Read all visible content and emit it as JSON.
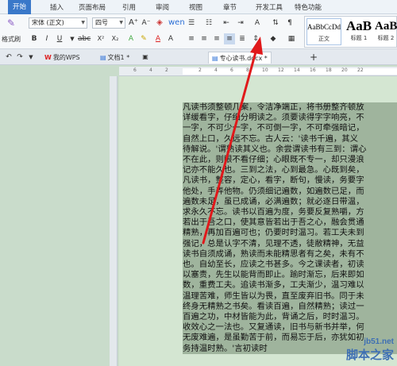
{
  "menubar": {
    "items": [
      "开始",
      "插入",
      "页面布局",
      "引用",
      "审阅",
      "视图",
      "章节",
      "开发工具",
      "特色功能"
    ]
  },
  "ribbon": {
    "format_painter": "格式刷",
    "font_name": "宋体 (正文)",
    "font_size": "四号",
    "styles": [
      {
        "sample": "AaBbCcDd",
        "name": "正文"
      },
      {
        "sample": "AaB",
        "name": "标题 1"
      },
      {
        "sample": "AaB",
        "name": "标题 2"
      }
    ]
  },
  "tabbar": {
    "tabs": [
      {
        "icon": "W",
        "label": "我的WPS"
      },
      {
        "icon": "▤",
        "label": "文档1 *"
      },
      {
        "icon": "▤",
        "label": "专心读书.docx *"
      }
    ],
    "new_tab": "+"
  },
  "ruler": {
    "ticks": [
      "6",
      "4",
      "2",
      "2",
      "4",
      "6",
      "8",
      "10",
      "12",
      "14",
      "16",
      "18",
      "20",
      "22"
    ]
  },
  "document": {
    "lines": [
      "凡读书须整顿几案，令洁净端正，将书册整齐顿放",
      "详缓看字，仔细分明读之。须要读得字字响亮，不",
      "一字，不可少一字，不可倒一字，不可牵强暗记，",
      "自然上口，久远不忘。古人云：'读书千遍，其义",
      "待解说。'谓熟读其义也。余尝谓读书有三到：谓心",
      "不在此，则眼不看仔细；心眼既不专一，却只漫浪",
      "记亦不能久也。三到之法，心到最急。心既到矣，",
      "凡读书，整容，定心，看字，断句，慢读，务要字",
      "他处，手弄他物。仍须细记遍数，如遍数已足，而",
      "遍数未足，虽已成诵，必满遍数；就必逐日带温，",
      "求永久不忘。读书以百遍为度，务要反复熟嚼，方",
      "若出于吾之口，使其意皆若出于吾之心，融会贯通",
      "精熟，再加百遍可也；仍要时时温习。若工夫未到",
      "强记，总是认字不清，见理不透，徒敝精神，无益",
      "读书自须成诵，熟读而未能精思者有之矣，未有不",
      "也。自幼至长，应读之书甚多。今之课读者，初读",
      "以塞责，先生以能背而即止。踰时渐忘，后来即如",
      "数，重费工夫。追读书渐多，工夫渐少，温习难以",
      "温理苦难，师生皆以为畏，直至废弃旧书。同于未",
      "终身无精熟之书矣。看读百遍，自然精熟；读过一",
      "百遍之功，中材皆能为此，背诵之后，时时温习。",
      "收效心之一法也。又复通读，旧书与新书并举，何",
      "无废难遍，是虽勤苦于前，而易忘于后，亦犹如初",
      "务持温时熟。'言初读时"
    ]
  },
  "watermark": {
    "site": "jb51.net",
    "name": "脚本之家"
  }
}
